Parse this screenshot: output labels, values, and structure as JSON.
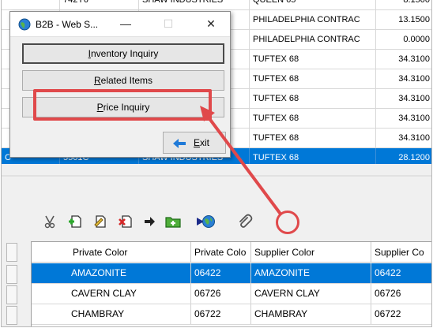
{
  "upper_grid": {
    "rows": [
      {
        "a": "",
        "b": "742Y6",
        "c": "SHAW INDUSTRIES",
        "d": "QUEEN 65",
        "e": "8.1500",
        "sel": false
      },
      {
        "a": "",
        "b": "",
        "c": "",
        "d": "PHILADELPHIA CONTRAC",
        "e": "13.1500",
        "sel": false
      },
      {
        "a": "",
        "b": "",
        "c": "",
        "d": "PHILADELPHIA CONTRAC",
        "e": "0.0000",
        "sel": false
      },
      {
        "a": "",
        "b": "",
        "c": "",
        "d": "TUFTEX 68",
        "e": "34.3100",
        "sel": false
      },
      {
        "a": "",
        "b": "",
        "c": "",
        "d": "TUFTEX 68",
        "e": "34.3100",
        "sel": false
      },
      {
        "a": "",
        "b": "",
        "c": "",
        "d": "TUFTEX 68",
        "e": "34.3100",
        "sel": false
      },
      {
        "a": "",
        "b": "",
        "c": "",
        "d": "TUFTEX 68",
        "e": "34.3100",
        "sel": false
      },
      {
        "a": "",
        "b": "",
        "c": "",
        "d": "TUFTEX 68",
        "e": "34.3100",
        "sel": false
      },
      {
        "a": "C",
        "b": "5501C",
        "c": "SHAW INDUSTRIES",
        "d": "TUFTEX 68",
        "e": "28.1200",
        "sel": true
      }
    ]
  },
  "toolbar": {
    "icons": [
      "scissors-icon",
      "add-doc-icon",
      "edit-doc-icon",
      "delete-doc-icon",
      "arrow-right-icon",
      "add-folder-icon",
      "play-icon",
      "globe-icon",
      "paperclip-icon"
    ],
    "colors": {
      "green": "#2ea82e",
      "red": "#d62828",
      "globe": "#2a7fd4"
    }
  },
  "lower_grid": {
    "headers": [
      "Private Color",
      "Private Colo",
      "Supplier Color",
      "Supplier Co"
    ],
    "rows": [
      {
        "private_color": "AMAZONITE",
        "private_code": "06422",
        "supplier_color": "AMAZONITE",
        "supplier_code": "06422",
        "sel": true
      },
      {
        "private_color": "CAVERN CLAY",
        "private_code": "06726",
        "supplier_color": "CAVERN CLAY",
        "supplier_code": "06726",
        "sel": false
      },
      {
        "private_color": "CHAMBRAY",
        "private_code": "06722",
        "supplier_color": "CHAMBRAY",
        "supplier_code": "06722",
        "sel": false
      }
    ]
  },
  "dialog": {
    "title": "B2B - Web S...",
    "minimize": "—",
    "maximize": "☐",
    "close": "✕",
    "buttons": {
      "inventory_pre": "",
      "inventory_acc": "I",
      "inventory_post": "nventory Inquiry",
      "related_pre": "",
      "related_acc": "R",
      "related_post": "elated Items",
      "price_pre": "",
      "price_acc": "P",
      "price_post": "rice Inquiry",
      "exit_pre": "",
      "exit_acc": "E",
      "exit_post": "xit"
    }
  },
  "highlight_color": "#e0494b",
  "selection_color": "#0078d7"
}
